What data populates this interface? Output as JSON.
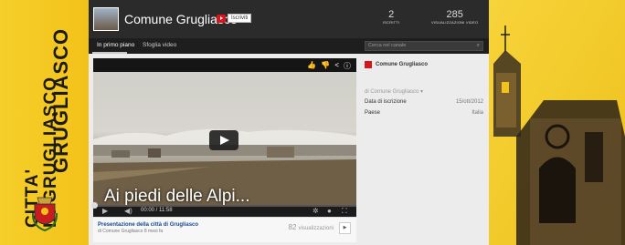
{
  "banner": {
    "city_line1": "CITTA'",
    "city_line2": "DI GRUGLIASCO",
    "name": "GRUGLIASCO"
  },
  "channel": {
    "title": "Comune Grugliasco",
    "subscribe_label": "Iscriviti",
    "stats": [
      {
        "value": "2",
        "label": "iscritti"
      },
      {
        "value": "285",
        "label": "visualizzazioni video"
      }
    ]
  },
  "nav": {
    "tabs": [
      {
        "label": "In primo piano",
        "active": true
      },
      {
        "label": "Sfoglia video",
        "active": false
      }
    ],
    "search_placeholder": "Cerca nel canale"
  },
  "player": {
    "caption": "Ai piedi delle Alpi...",
    "time_current": "00:00",
    "time_total": "11:58",
    "time_display": "00:00 / 11:58",
    "progress": 0
  },
  "video": {
    "title": "Presentazione della città di Grugliasco",
    "subtitle": "di Comune Grugliasco 8 mesi fa",
    "views_count": "82",
    "views_label": "visualizzazioni"
  },
  "side": {
    "channel_name": "Comune Grugliasco",
    "by_label": "di Comune Grugliasco",
    "rows": [
      {
        "label": "Data di iscrizione",
        "value": "15/ott/2012"
      },
      {
        "label": "Paese",
        "value": "Italia"
      }
    ]
  },
  "colors": {
    "yellow": "#f2c21a",
    "header_dark": "#2b2b2b",
    "youtube_red": "#d6161b",
    "link_blue": "#1a4a8a"
  }
}
